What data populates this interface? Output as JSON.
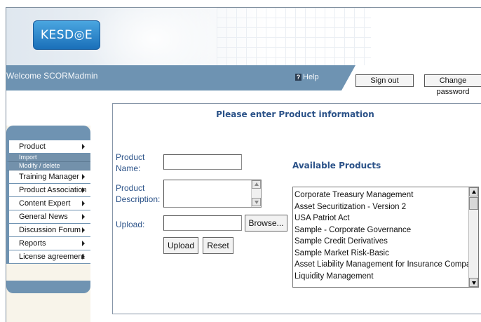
{
  "header": {
    "logo_text": "KESD◎E"
  },
  "topbar": {
    "welcome": "Welcome SCORMadmin",
    "help_icon_glyph": "?",
    "help": "Help",
    "sign_out": "Sign out",
    "change_password": "Change password"
  },
  "sidebar": {
    "items": [
      {
        "label": "Product",
        "has_arrow": true
      },
      {
        "label": "Import",
        "sub": true
      },
      {
        "label": "Modify / delete",
        "sub": true
      },
      {
        "label": "Training Manager",
        "has_arrow": true
      },
      {
        "label": "Product Association",
        "has_arrow": true
      },
      {
        "label": "Content Expert",
        "has_arrow": true
      },
      {
        "label": "General News",
        "has_arrow": true
      },
      {
        "label": "Discussion Forum",
        "has_arrow": true
      },
      {
        "label": "Reports",
        "has_arrow": true
      },
      {
        "label": "License agreement",
        "has_arrow": true
      }
    ]
  },
  "form": {
    "title": "Please enter Product information",
    "product_name_label_1": "Product",
    "product_name_label_2": "Name:",
    "product_desc_label_1": "Product",
    "product_desc_label_2": "Description:",
    "upload_label": "Upload:",
    "product_name_value": "",
    "product_desc_value": "",
    "upload_value": "",
    "browse": "Browse...",
    "upload_button": "Upload",
    "reset_button": "Reset"
  },
  "available": {
    "title": "Available Products",
    "items": [
      "Corporate Treasury Management",
      "Asset Securitization - Version 2",
      "USA Patriot Act",
      "Sample - Corporate Governance",
      "Sample Credit Derivatives",
      "Sample Market Risk-Basic",
      "Asset Liability Management for Insurance Companies",
      "Liquidity Management"
    ]
  }
}
